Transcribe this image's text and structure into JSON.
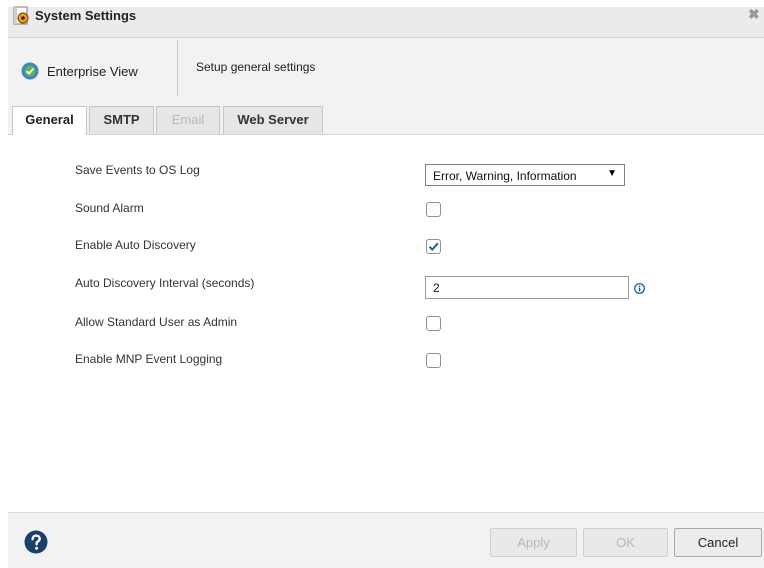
{
  "window": {
    "title": "System Settings",
    "close_icon": "close-icon"
  },
  "header": {
    "nav_label": "Enterprise View",
    "nav_icon": "enterprise-view-icon",
    "subtitle": "Setup general settings"
  },
  "tabs": [
    {
      "label": "General",
      "active": true,
      "enabled": true
    },
    {
      "label": "SMTP",
      "active": false,
      "enabled": true
    },
    {
      "label": "Email",
      "active": false,
      "enabled": false
    },
    {
      "label": "Web Server",
      "active": false,
      "enabled": true
    }
  ],
  "settings": {
    "save_events": {
      "label": "Save Events to OS Log",
      "value": "Error, Warning, Information"
    },
    "sound_alarm": {
      "label": "Sound Alarm",
      "checked": false
    },
    "auto_discovery": {
      "label": "Enable Auto Discovery",
      "checked": true
    },
    "discovery_interval": {
      "label": "Auto Discovery Interval (seconds)",
      "value": "2",
      "info_icon": "info-icon"
    },
    "standard_user_admin": {
      "label": "Allow Standard User as Admin",
      "checked": false
    },
    "mnp_logging": {
      "label": "Enable MNP Event Logging",
      "checked": false
    }
  },
  "footer": {
    "help_icon": "help-icon",
    "apply_label": "Apply",
    "ok_label": "OK",
    "cancel_label": "Cancel"
  },
  "colors": {
    "checkmark": "#1e5f9b",
    "help_icon": "#1a3f6b",
    "disabled_text": "#b9b9b9"
  }
}
